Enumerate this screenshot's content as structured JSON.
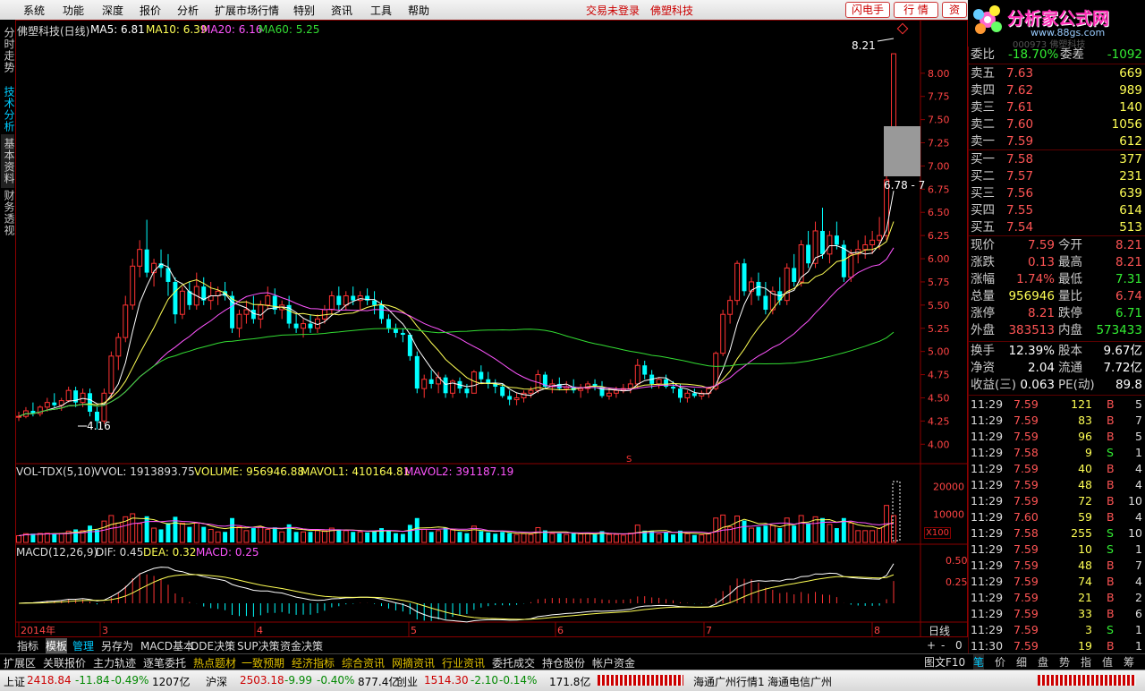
{
  "menu": [
    "系统",
    "功能",
    "深度",
    "报价",
    "分析",
    "扩展市场行情",
    "特别",
    "资讯",
    "工具",
    "帮助"
  ],
  "status": {
    "login": "交易未登录",
    "name": "佛塑科技"
  },
  "top_buttons": [
    "闪电手",
    "行 情",
    "资"
  ],
  "logo": {
    "text": "分析家公式网",
    "url": "www.88gs.com",
    "code": "000973 佛塑科技"
  },
  "left_tabs": [
    "分时走势",
    "技术分析",
    "基本资料",
    "财务透视"
  ],
  "kline": {
    "title": "佛塑科技(日线)",
    "ma": [
      {
        "label": "MA5: 6.81",
        "color": "#ffffff"
      },
      {
        "label": "MA10: 6.39",
        "color": "#ffff55"
      },
      {
        "label": "MA20: 6.16",
        "color": "#ff55ff"
      },
      {
        "label": "MA60: 5.25",
        "color": "#33dd33"
      }
    ],
    "y_ticks": [
      "8.00",
      "7.75",
      "7.50",
      "7.25",
      "7.00",
      "6.75",
      "6.50",
      "6.25",
      "6.00",
      "5.75",
      "5.50",
      "5.25",
      "5.00",
      "4.75",
      "4.50",
      "4.25",
      "4.00"
    ],
    "annot_high": "8.21",
    "annot_low": "4.16",
    "annot_box": "6.78 - 7",
    "marker": "S"
  },
  "vol": {
    "label": "VOL-TDX(5,10)",
    "vvol": "VVOL: 1913893.75",
    "volume": "VOLUME: 956946.88",
    "mavol1": "MAVOL1: 410164.81",
    "mavol2": "MAVOL2: 391187.19",
    "y_ticks": [
      "20000",
      "10000"
    ],
    "unit": "X100"
  },
  "macd": {
    "label": "MACD(12,26,9)",
    "dif": "DIF: 0.45",
    "dea": "DEA: 0.32",
    "macd": "MACD: 0.25",
    "y_ticks": [
      "0.50",
      "0.25"
    ]
  },
  "x_axis": [
    "2014年",
    "3",
    "4",
    "5",
    "6",
    "7",
    "8"
  ],
  "chart_data": {
    "type": "candlestick",
    "title": "佛塑科技(日线)",
    "candles": [
      [
        4.3,
        4.35,
        4.25,
        4.3
      ],
      [
        4.3,
        4.4,
        4.28,
        4.36
      ],
      [
        4.36,
        4.45,
        4.3,
        4.33
      ],
      [
        4.33,
        4.42,
        4.3,
        4.4
      ],
      [
        4.4,
        4.5,
        4.35,
        4.45
      ],
      [
        4.45,
        4.55,
        4.4,
        4.42
      ],
      [
        4.42,
        4.5,
        4.36,
        4.47
      ],
      [
        4.47,
        4.62,
        4.45,
        4.58
      ],
      [
        4.58,
        4.62,
        4.4,
        4.45
      ],
      [
        4.45,
        4.6,
        4.4,
        4.55
      ],
      [
        4.55,
        4.6,
        4.3,
        4.35
      ],
      [
        4.35,
        4.4,
        4.16,
        4.25
      ],
      [
        4.25,
        4.6,
        4.22,
        4.55
      ],
      [
        4.55,
        5.0,
        4.5,
        4.95
      ],
      [
        4.95,
        5.2,
        4.8,
        5.15
      ],
      [
        5.15,
        5.6,
        5.1,
        5.5
      ],
      [
        5.5,
        6.0,
        5.45,
        5.92
      ],
      [
        5.92,
        6.2,
        5.8,
        6.1
      ],
      [
        6.1,
        6.42,
        5.8,
        5.85
      ],
      [
        5.85,
        6.0,
        5.7,
        5.95
      ],
      [
        5.95,
        6.1,
        5.8,
        5.9
      ],
      [
        5.9,
        6.05,
        5.6,
        5.75
      ],
      [
        5.75,
        5.8,
        5.3,
        5.4
      ],
      [
        5.4,
        5.7,
        5.35,
        5.65
      ],
      [
        5.65,
        5.75,
        5.45,
        5.5
      ],
      [
        5.5,
        5.85,
        5.45,
        5.7
      ],
      [
        5.7,
        5.8,
        5.5,
        5.55
      ],
      [
        5.55,
        5.75,
        5.45,
        5.6
      ],
      [
        5.6,
        5.7,
        5.5,
        5.65
      ],
      [
        5.65,
        5.75,
        5.55,
        5.6
      ],
      [
        5.6,
        5.65,
        5.2,
        5.25
      ],
      [
        5.25,
        5.45,
        5.15,
        5.4
      ],
      [
        5.4,
        5.55,
        5.3,
        5.45
      ],
      [
        5.45,
        5.6,
        5.3,
        5.35
      ],
      [
        5.35,
        5.55,
        5.25,
        5.5
      ],
      [
        5.5,
        5.7,
        5.45,
        5.6
      ],
      [
        5.6,
        5.68,
        5.4,
        5.45
      ],
      [
        5.45,
        5.55,
        5.35,
        5.5
      ],
      [
        5.5,
        5.6,
        5.25,
        5.3
      ],
      [
        5.3,
        5.4,
        5.2,
        5.25
      ],
      [
        5.25,
        5.35,
        5.15,
        5.3
      ],
      [
        5.3,
        5.4,
        5.2,
        5.25
      ],
      [
        5.25,
        5.4,
        5.2,
        5.35
      ],
      [
        5.35,
        5.5,
        5.3,
        5.45
      ],
      [
        5.45,
        5.65,
        5.4,
        5.6
      ],
      [
        5.6,
        5.7,
        5.45,
        5.5
      ],
      [
        5.5,
        5.65,
        5.45,
        5.6
      ],
      [
        5.6,
        5.7,
        5.5,
        5.55
      ],
      [
        5.55,
        5.65,
        5.45,
        5.6
      ],
      [
        5.6,
        5.68,
        5.5,
        5.55
      ],
      [
        5.55,
        5.65,
        5.4,
        5.5
      ],
      [
        5.5,
        5.55,
        5.3,
        5.35
      ],
      [
        5.35,
        5.4,
        5.2,
        5.25
      ],
      [
        5.25,
        5.3,
        5.15,
        5.2
      ],
      [
        5.2,
        5.25,
        5.1,
        5.18
      ],
      [
        5.18,
        5.2,
        4.9,
        4.95
      ],
      [
        4.95,
        5.0,
        4.55,
        4.6
      ],
      [
        4.6,
        4.75,
        4.5,
        4.7
      ],
      [
        4.7,
        4.8,
        4.6,
        4.65
      ],
      [
        4.65,
        4.78,
        4.55,
        4.72
      ],
      [
        4.72,
        4.75,
        4.5,
        4.55
      ],
      [
        4.55,
        4.7,
        4.5,
        4.68
      ],
      [
        4.68,
        4.72,
        4.55,
        4.6
      ],
      [
        4.6,
        4.65,
        4.5,
        4.55
      ],
      [
        4.55,
        4.8,
        4.55,
        4.78
      ],
      [
        4.78,
        4.85,
        4.65,
        4.7
      ],
      [
        4.7,
        4.78,
        4.6,
        4.65
      ],
      [
        4.65,
        4.7,
        4.55,
        4.62
      ],
      [
        4.62,
        4.65,
        4.5,
        4.52
      ],
      [
        4.52,
        4.58,
        4.42,
        4.48
      ],
      [
        4.48,
        4.55,
        4.42,
        4.5
      ],
      [
        4.5,
        4.58,
        4.45,
        4.55
      ],
      [
        4.55,
        4.62,
        4.5,
        4.58
      ],
      [
        4.58,
        4.8,
        4.55,
        4.75
      ],
      [
        4.75,
        4.78,
        4.6,
        4.62
      ],
      [
        4.62,
        4.7,
        4.55,
        4.65
      ],
      [
        4.65,
        4.72,
        4.58,
        4.6
      ],
      [
        4.6,
        4.68,
        4.55,
        4.62
      ],
      [
        4.62,
        4.7,
        4.55,
        4.58
      ],
      [
        4.58,
        4.65,
        4.5,
        4.6
      ],
      [
        4.6,
        4.68,
        4.55,
        4.65
      ],
      [
        4.65,
        4.7,
        4.58,
        4.62
      ],
      [
        4.62,
        4.68,
        4.5,
        4.52
      ],
      [
        4.52,
        4.6,
        4.48,
        4.55
      ],
      [
        4.55,
        4.62,
        4.5,
        4.58
      ],
      [
        4.58,
        4.65,
        4.55,
        4.6
      ],
      [
        4.6,
        4.7,
        4.55,
        4.65
      ],
      [
        4.65,
        4.92,
        4.6,
        4.85
      ],
      [
        4.85,
        4.9,
        4.7,
        4.75
      ],
      [
        4.75,
        4.8,
        4.6,
        4.65
      ],
      [
        4.65,
        4.72,
        4.6,
        4.7
      ],
      [
        4.7,
        4.75,
        4.6,
        4.62
      ],
      [
        4.62,
        4.68,
        4.55,
        4.6
      ],
      [
        4.6,
        4.65,
        4.45,
        4.5
      ],
      [
        4.5,
        4.58,
        4.45,
        4.55
      ],
      [
        4.55,
        4.6,
        4.5,
        4.52
      ],
      [
        4.52,
        4.58,
        4.48,
        4.55
      ],
      [
        4.55,
        4.62,
        4.5,
        4.6
      ],
      [
        4.6,
        5.0,
        4.58,
        4.98
      ],
      [
        4.98,
        5.45,
        4.95,
        5.4
      ],
      [
        5.4,
        5.6,
        5.3,
        5.55
      ],
      [
        5.55,
        5.98,
        5.5,
        5.95
      ],
      [
        5.95,
        6.0,
        5.6,
        5.65
      ],
      [
        5.65,
        5.8,
        5.5,
        5.75
      ],
      [
        5.75,
        5.85,
        5.55,
        5.6
      ],
      [
        5.6,
        5.75,
        5.4,
        5.45
      ],
      [
        5.45,
        5.7,
        5.4,
        5.65
      ],
      [
        5.65,
        5.8,
        5.5,
        5.55
      ],
      [
        5.55,
        5.95,
        5.5,
        5.9
      ],
      [
        5.9,
        6.05,
        5.7,
        5.75
      ],
      [
        5.75,
        6.2,
        5.7,
        6.15
      ],
      [
        6.15,
        6.3,
        5.9,
        5.95
      ],
      [
        5.95,
        6.4,
        5.9,
        6.3
      ],
      [
        6.3,
        6.55,
        6.0,
        6.05
      ],
      [
        6.05,
        6.3,
        5.95,
        6.25
      ],
      [
        6.25,
        6.4,
        6.1,
        6.15
      ],
      [
        6.15,
        6.2,
        5.75,
        5.8
      ],
      [
        5.8,
        6.1,
        5.75,
        6.05
      ],
      [
        6.05,
        6.2,
        5.95,
        6.1
      ],
      [
        6.1,
        6.25,
        6.0,
        6.15
      ],
      [
        6.15,
        6.3,
        6.05,
        6.2
      ],
      [
        6.2,
        6.45,
        6.1,
        6.25
      ],
      [
        6.25,
        6.9,
        6.2,
        6.85
      ],
      [
        7.31,
        8.21,
        7.31,
        8.21
      ]
    ]
  },
  "right": {
    "top": {
      "label1": "委比",
      "val1": "-18.70%",
      "label2": "委差",
      "val2": "-1092"
    },
    "sell": [
      {
        "label": "卖五",
        "price": "7.63",
        "vol": "669"
      },
      {
        "label": "卖四",
        "price": "7.62",
        "vol": "989"
      },
      {
        "label": "卖三",
        "price": "7.61",
        "vol": "140"
      },
      {
        "label": "卖二",
        "price": "7.60",
        "vol": "1056"
      },
      {
        "label": "卖一",
        "price": "7.59",
        "vol": "612"
      }
    ],
    "buy": [
      {
        "label": "买一",
        "price": "7.58",
        "vol": "377"
      },
      {
        "label": "买二",
        "price": "7.57",
        "vol": "231"
      },
      {
        "label": "买三",
        "price": "7.56",
        "vol": "639"
      },
      {
        "label": "买四",
        "price": "7.55",
        "vol": "614"
      },
      {
        "label": "买五",
        "price": "7.54",
        "vol": "513"
      }
    ],
    "quote": [
      {
        "l1": "现价",
        "v1": "7.59",
        "c1": "#ff5555",
        "l2": "今开",
        "v2": "8.21",
        "c2": "#ff5555"
      },
      {
        "l1": "涨跌",
        "v1": "0.13",
        "c1": "#ff5555",
        "l2": "最高",
        "v2": "8.21",
        "c2": "#ff5555"
      },
      {
        "l1": "涨幅",
        "v1": "1.74%",
        "c1": "#ff5555",
        "l2": "最低",
        "v2": "7.31",
        "c2": "#33ee33"
      },
      {
        "l1": "总量",
        "v1": "956946",
        "c1": "#ffff55",
        "l2": "量比",
        "v2": "6.74",
        "c2": "#ff5555"
      },
      {
        "l1": "涨停",
        "v1": "8.21",
        "c1": "#ff5555",
        "l2": "跌停",
        "v2": "6.71",
        "c2": "#33ee33"
      },
      {
        "l1": "外盘",
        "v1": "383513",
        "c1": "#ff5555",
        "l2": "内盘",
        "v2": "573433",
        "c2": "#33ee33"
      }
    ],
    "fundamental": [
      {
        "l1": "换手",
        "v1": "12.39%",
        "l2": "股本",
        "v2": "9.67亿"
      },
      {
        "l1": "净资",
        "v1": "2.04",
        "l2": "流通",
        "v2": "7.72亿"
      },
      {
        "l1": "收益(三)",
        "v1": "0.063",
        "l2": "PE(动)",
        "v2": "89.8"
      }
    ],
    "ticks": [
      [
        "11:29",
        "7.59",
        "121",
        "B",
        "5"
      ],
      [
        "11:29",
        "7.59",
        "83",
        "B",
        "7"
      ],
      [
        "11:29",
        "7.59",
        "96",
        "B",
        "5"
      ],
      [
        "11:29",
        "7.58",
        "9",
        "S",
        "1"
      ],
      [
        "11:29",
        "7.59",
        "40",
        "B",
        "4"
      ],
      [
        "11:29",
        "7.59",
        "48",
        "B",
        "4"
      ],
      [
        "11:29",
        "7.59",
        "72",
        "B",
        "10"
      ],
      [
        "11:29",
        "7.60",
        "59",
        "B",
        "4"
      ],
      [
        "11:29",
        "7.58",
        "255",
        "S",
        "10"
      ],
      [
        "11:29",
        "7.59",
        "10",
        "S",
        "1"
      ],
      [
        "11:29",
        "7.59",
        "48",
        "B",
        "7"
      ],
      [
        "11:29",
        "7.59",
        "74",
        "B",
        "4"
      ],
      [
        "11:29",
        "7.59",
        "21",
        "B",
        "2"
      ],
      [
        "11:29",
        "7.59",
        "33",
        "B",
        "6"
      ],
      [
        "11:29",
        "7.59",
        "3",
        "S",
        "1"
      ],
      [
        "11:30",
        "7.59",
        "19",
        "B",
        "1"
      ]
    ]
  },
  "bottom_tabs": [
    "指标",
    "模板",
    "管理",
    "另存为",
    "MACD基本",
    "DDE决策",
    "SUP决策",
    "资金决策"
  ],
  "right_small": {
    "period": "日线",
    "plus": "+",
    "minus": "-",
    "zero": "0",
    "mode": "图文F10"
  },
  "sector_buttons": [
    {
      "t": "扩展区",
      "c": "#dddddd"
    },
    {
      "t": "关联报价",
      "c": "#dddddd"
    },
    {
      "t": "主力轨迹",
      "c": "#dddddd"
    },
    {
      "t": "逐笔委托",
      "c": "#dddddd"
    },
    {
      "t": "热点题材",
      "c": "#e0c000"
    },
    {
      "t": "一致预期",
      "c": "#e0c000"
    },
    {
      "t": "经济指标",
      "c": "#e0c000"
    },
    {
      "t": "综合资讯",
      "c": "#e0c000"
    },
    {
      "t": "网摘资讯",
      "c": "#e0c000"
    },
    {
      "t": "行业资讯",
      "c": "#e0c000"
    },
    {
      "t": "委托成交",
      "c": "#dddddd"
    },
    {
      "t": "持仓股份",
      "c": "#dddddd"
    },
    {
      "t": "帐户资金",
      "c": "#dddddd"
    }
  ],
  "right_bottom_tabs": [
    "笔",
    "价",
    "细",
    "盘",
    "势",
    "指",
    "值",
    "筹"
  ],
  "index_bar": [
    {
      "t": "上证",
      "c": "#000"
    },
    {
      "t": "2418.84",
      "c": "#c00"
    },
    {
      "t": "-11.84",
      "c": "#080"
    },
    {
      "t": "-0.49%",
      "c": "#080"
    },
    {
      "t": "1207亿",
      "c": "#000"
    },
    {
      "t": "沪深",
      "c": "#000"
    },
    {
      "t": "2503.18",
      "c": "#c00"
    },
    {
      "t": "-9.99",
      "c": "#080"
    },
    {
      "t": "-0.40%",
      "c": "#080"
    },
    {
      "t": "877.4亿",
      "c": "#000"
    },
    {
      "t": "创业",
      "c": "#000"
    },
    {
      "t": "1514.30",
      "c": "#c00"
    },
    {
      "t": "-2.10",
      "c": "#080"
    },
    {
      "t": "-0.14%",
      "c": "#080"
    },
    {
      "t": "171.8亿",
      "c": "#000"
    }
  ],
  "broker": [
    "海通广州行情1",
    "海通电信广州"
  ],
  "colors": {
    "up": "#ff3333",
    "down": "#00ffff",
    "grid": "#8b0000"
  }
}
